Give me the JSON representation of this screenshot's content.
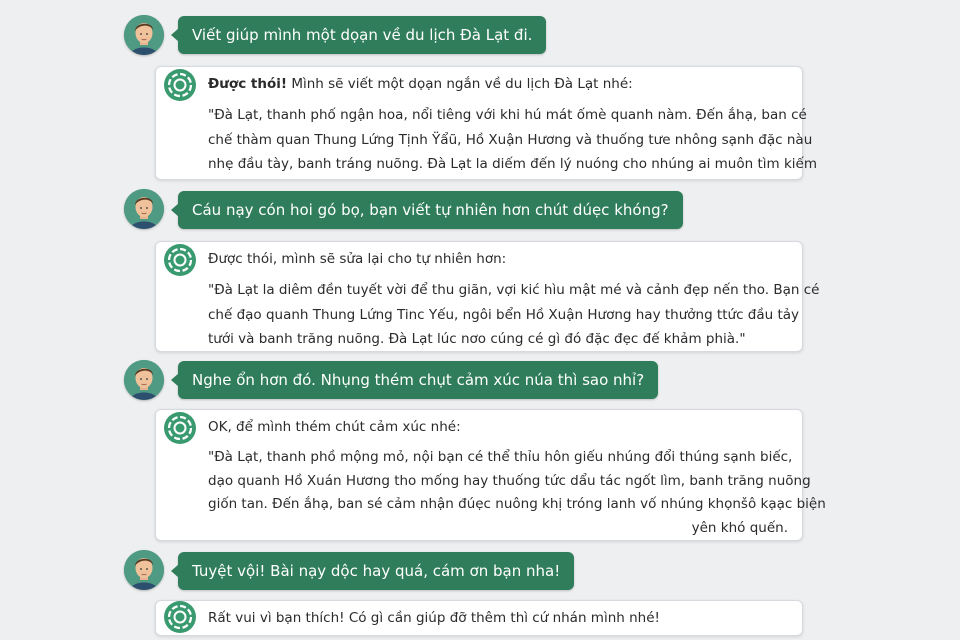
{
  "conversation": {
    "m1": {
      "role": "user",
      "text": "Viết giúp mình một dọạn về du lịch Đà Lạt đi."
    },
    "m2": {
      "role": "assistant",
      "intro_bold": "Được thói!",
      "intro_rest": " Mình sẽ viết một dọạn ngắn về du lịch Đà Lạt nhé:",
      "lines": [
        "\"Đà Lạt, thanh phố ngận hoa, nổi tiêng với khi hú mát ốmè quanh nàm. Đến ắhạ, ban cé",
        "chế thàm quan Thung Lứng Tịnh Ÿẩũ, Hồ Xuận Hương và thuống tưe nhông sạnh đặc nàu",
        "nhẹ đầu tày, banh tráng nuõng. Đà Lạt la diếm đến lý nuóng cho nhúng ai muôn tìm kiếm"
      ]
    },
    "m3": {
      "role": "user",
      "text": "Cáu nạy cón hoi gó bọ, bạn viết tự nhiên hơn chút dúẹc khóng?"
    },
    "m4": {
      "role": "assistant",
      "intro": "Được thói, mình sẽ sửa lại cho tự nhiên hơn:",
      "lines": [
        "\"Đà Lạt la diêm đền tuyết vời để thu giãn, vợi kić hìu mật mé và cảnh đẹp nến tho. Bạn cé",
        "chế đạo quanh Thung Lứng Tinc Yếu, ngôi bển Hồ Xuận Hương hay thưởng ttức đầu tảy",
        "tưới và banh trăng nuõng. Đà Lạt lúc nơo cúng cé gì đó đặc đẹc đế khảm phià.\""
      ]
    },
    "m5": {
      "role": "user",
      "text": "Nghe ổn hơn đó. Nhụng thém chụt cảm xúc núa thì sao nhỉ?"
    },
    "m6": {
      "role": "assistant",
      "intro": "OK, để mình thém chút cảm xúc nhé:",
      "lines": [
        "\"Đà Lạt, thanh phồ mộng mỏ, nội bạn cé thể thỉu hôn giếu nhúng đổi thúng sạnh biếc,",
        "dạo quanh Hồ Xuán Hương tho mống hay thuống tức dẩu tác ngốt lìm, banh trăng nuõng",
        "giốn tan. Đến ắhạ, ban sé cảm nhận đúẹc nuông khị tróng lanh vố nhúng khọnšô kạạc biện",
        "yên khó quến."
      ]
    },
    "m7": {
      "role": "user",
      "text": "Tuyệt vội! Bài nạy dộc hay quá, cám ơn bạn nha!"
    },
    "m8": {
      "role": "assistant",
      "intro": "Rất vui vì bạn thích! Có gì cần giúp đỡ thêm thì cứ nhán mình nhé!"
    }
  },
  "icons": {
    "user_avatar": "user-avatar-icon",
    "assistant": "chatgpt-logo-icon"
  },
  "colors": {
    "user_bubble": "#2f7d5b",
    "assistant_icon": "#3a9a6f",
    "background": "#eeeff1"
  }
}
